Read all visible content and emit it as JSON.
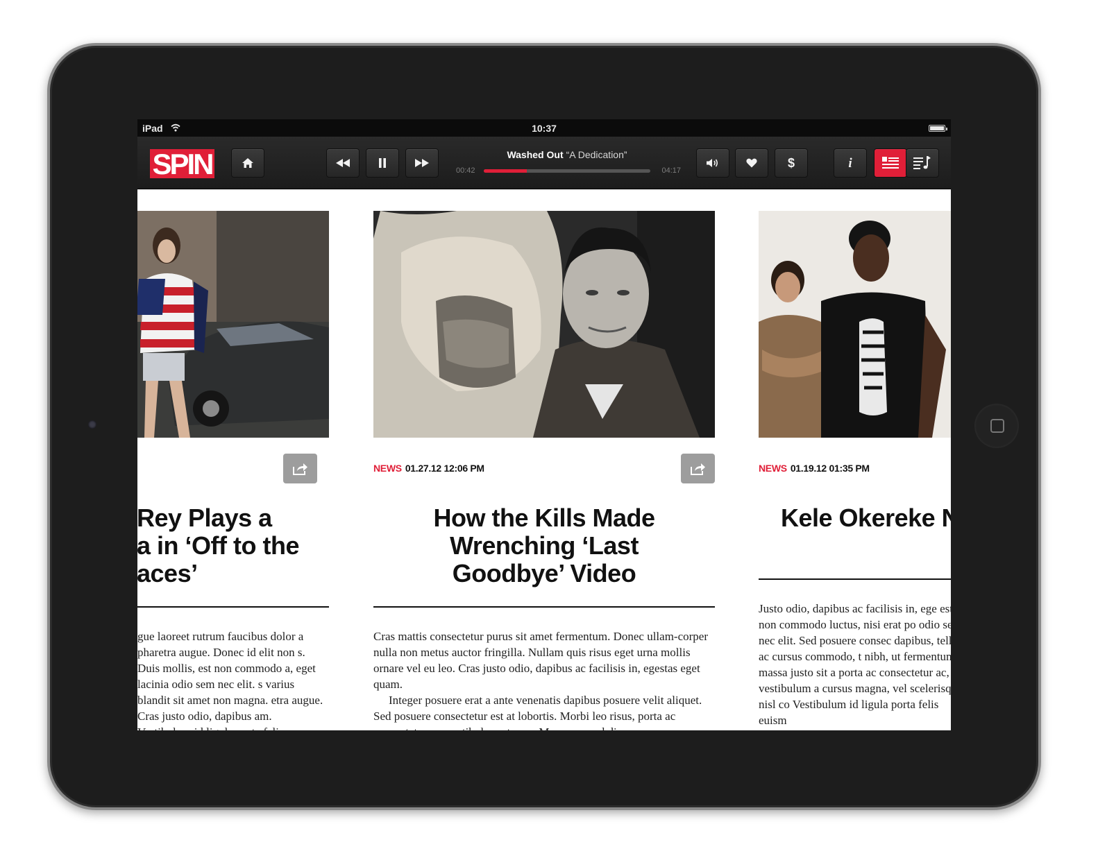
{
  "device": {
    "label": "iPad"
  },
  "status_bar": {
    "device": "iPad",
    "time": "10:37"
  },
  "toolbar": {
    "logo": "SPIN",
    "player": {
      "artist": "Washed Out",
      "song": "“A Dedication”",
      "elapsed": "00:42",
      "total": "04:17",
      "progress": 0.26
    }
  },
  "articles": [
    {
      "category": "",
      "date": "",
      "headline": "Rey Plays a\na in ‘Off to the\naces’",
      "body": [
        "gue laoreet rutrum faucibus dolor a pharetra augue. Donec id elit non s. Duis mollis, est non commodo a, eget lacinia odio sem nec elit. s varius blandit sit amet non magna. etra augue. Cras justo odio, dapibus am. Vestibulum id ligula porta felis"
      ]
    },
    {
      "category": "NEWS",
      "date": "01.27.12 12:06 PM",
      "headline": "How the Kills Made\nWrenching ‘Last\nGoodbye’ Video",
      "body": [
        "Cras mattis consectetur purus sit amet fermentum. Donec ullam-corper nulla non metus auctor fringilla. Nullam quis risus eget urna mollis ornare vel eu leo. Cras justo odio, dapibus ac facilisis in, egestas eget quam.",
        "Integer posuere erat a ante venenatis dapibus posuere velit aliquet. Sed posuere consectetur est at lobortis. Morbi leo risus, porta ac consectetur ac, vestibulum at eros. Maecenas sed diam"
      ]
    },
    {
      "category": "NEWS",
      "date": "01.19.12 01:35 PM",
      "headline": "Kele Okereke\nNew Bloc Pa",
      "body": [
        "Justo odio, dapibus ac facilisis in, ege est non commodo luctus, nisi erat po odio sem nec elit. Sed posuere consec dapibus, tellus ac cursus commodo, t nibh, ut fermentum massa justo sit a porta ac consectetur ac, vestibulum a cursus magna, vel scelerisque nisl co Vestibulum id ligula porta felis euism"
      ]
    }
  ],
  "icons": {
    "home": "home-icon",
    "rewind": "rewind-icon",
    "pause": "pause-icon",
    "forward": "fast-forward-icon",
    "volume": "volume-icon",
    "favorite": "heart-icon",
    "buy": "dollar-icon",
    "info": "info-icon",
    "articles": "article-list-icon",
    "playlist": "playlist-icon",
    "share": "share-icon"
  },
  "colors": {
    "accent": "#e01f38",
    "toolbar": "#222222",
    "bezel": "#1d1d1d"
  }
}
